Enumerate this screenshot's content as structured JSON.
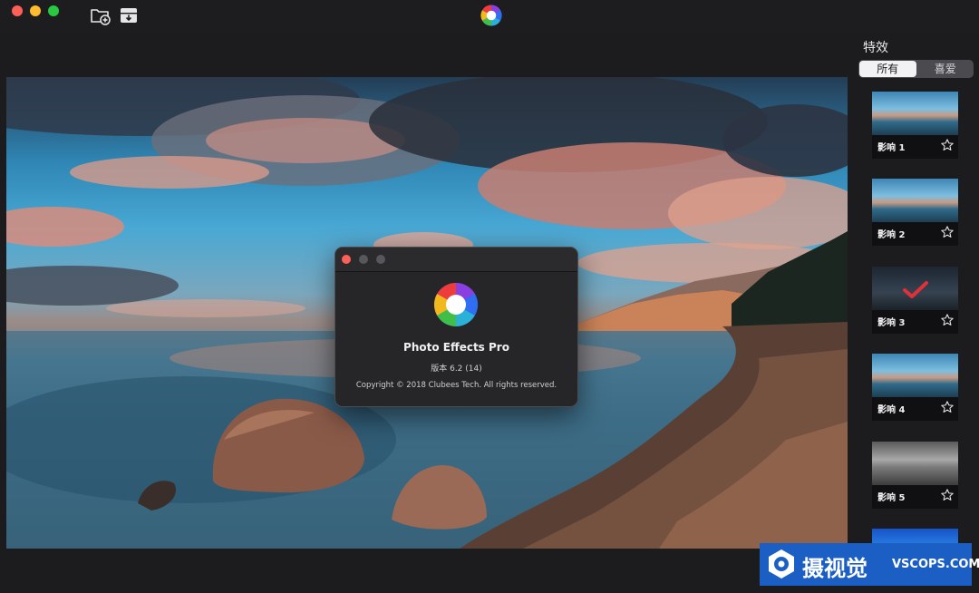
{
  "toolbar": {
    "new_icon": "folder-add-icon",
    "export_icon": "tray-download-icon",
    "app_logo_icon": "aperture-logo-icon"
  },
  "sidebar": {
    "title": "特效",
    "tabs": [
      {
        "label": "所有",
        "active": true
      },
      {
        "label": "喜爱",
        "active": false
      }
    ],
    "effects": [
      {
        "label": "影响 1",
        "favorite": false,
        "selected": false,
        "style": "color"
      },
      {
        "label": "影响 2",
        "favorite": false,
        "selected": false,
        "style": "color"
      },
      {
        "label": "影响 3",
        "favorite": false,
        "selected": true,
        "style": "dark"
      },
      {
        "label": "影响 4",
        "favorite": false,
        "selected": false,
        "style": "color"
      },
      {
        "label": "影响 5",
        "favorite": false,
        "selected": false,
        "style": "mono"
      },
      {
        "label": "",
        "favorite": false,
        "selected": false,
        "style": "blue"
      }
    ]
  },
  "about": {
    "app_name": "Photo Effects Pro",
    "version": "版本 6.2 (14)",
    "copyright": "Copyright © 2018 Clubees Tech. All rights reserved."
  },
  "watermark": {
    "text_cn": "摄视觉",
    "text_en": "VSCOPS.COM"
  },
  "colors": {
    "accent_red": "#e0303a",
    "window_bg": "#1c1c1f",
    "close": "#fe5f57",
    "minimize": "#febc2e",
    "maximize": "#28c840",
    "watermark_bg": "#1c5fc4"
  }
}
